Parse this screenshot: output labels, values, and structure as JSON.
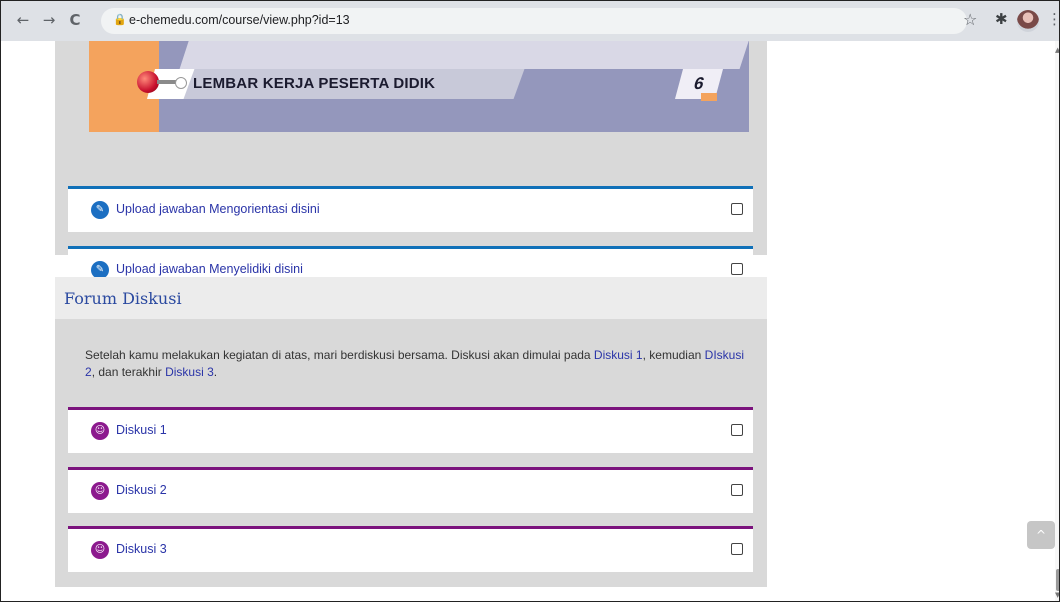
{
  "browser": {
    "url": "e-chemedu.com/course/view.php?id=13",
    "back_icon": "←",
    "forward_icon": "→",
    "reload_icon": "C",
    "lock_icon": "🔒",
    "star_icon": "☆",
    "extensions_icon": "✱",
    "menu_icon": "⋮"
  },
  "banner": {
    "title": "LEMBAR KERJA PESERTA DIDIK",
    "number": "6"
  },
  "section1": {
    "activities": [
      {
        "label": "Upload jawaban Mengorientasi disini",
        "icon": "assignment-icon"
      },
      {
        "label": "Upload jawaban Menyelidiki disini",
        "icon": "assignment-icon"
      }
    ]
  },
  "section2": {
    "title": "Forum Diskusi",
    "description": {
      "part1": "Setelah kamu melakukan kegiatan di atas, mari berdiskusi bersama. Diskusi akan dimulai pada ",
      "link1": "Diskusi 1",
      "part2": ", kemudian ",
      "link2": "DIskusi 2",
      "part3": ", dan terakhir ",
      "link3": "Diskusi 3",
      "part4": "."
    },
    "activities": [
      {
        "label": "Diskusi 1",
        "icon": "forum-icon"
      },
      {
        "label": "Diskusi 2",
        "icon": "forum-icon"
      },
      {
        "label": "Diskusi 3",
        "icon": "forum-icon"
      }
    ]
  },
  "scroll_top_icon": "^",
  "colors": {
    "assignment_accent": "#1070b8",
    "forum_accent": "#7b137d",
    "link": "#2a34a8"
  }
}
